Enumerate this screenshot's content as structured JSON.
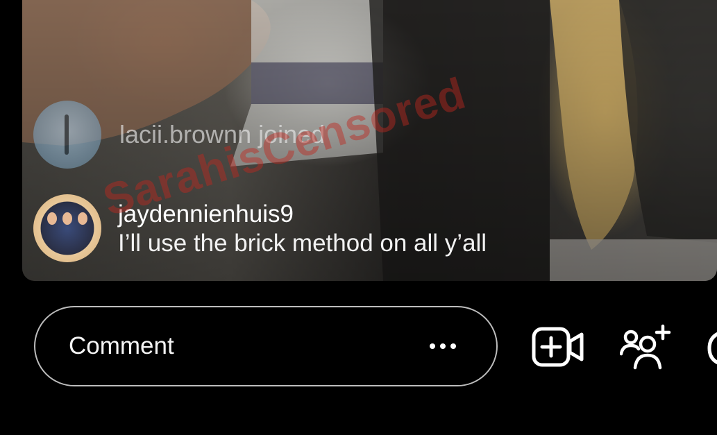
{
  "feed": {
    "join_event": {
      "username": "lacii.brownn",
      "text": "lacii.brownn joined"
    },
    "comment": {
      "username": "jaydennienhuis9",
      "text": "I’ll use the brick method on all y’all"
    }
  },
  "watermark": {
    "text": "SarahisCensored",
    "color": "#be281e"
  },
  "bottom_bar": {
    "comment_placeholder": "Comment",
    "more_icon": "more-horizontal-icon",
    "actions": [
      {
        "icon": "add-video-icon"
      },
      {
        "icon": "add-guest-icon"
      },
      {
        "icon": "camera-icon"
      }
    ]
  },
  "colors": {
    "background": "#000000",
    "input_border": "#bdbdbd",
    "text_primary": "#ffffff"
  }
}
